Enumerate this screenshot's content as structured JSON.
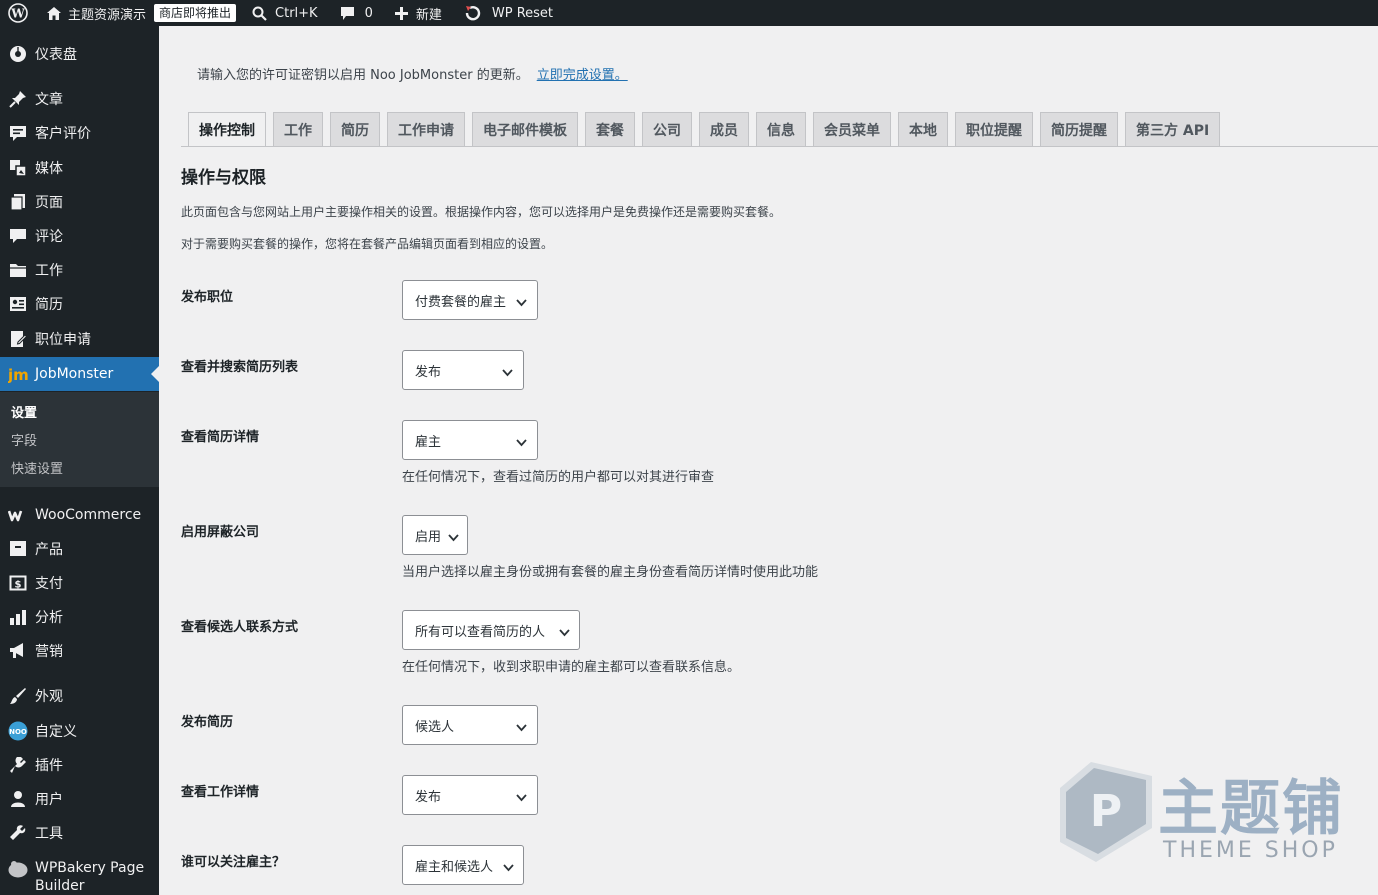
{
  "admin_bar": {
    "site_name": "主题资源演示",
    "store_badge": "商店即将推出",
    "search_shortcut": "Ctrl+K",
    "comments_count": "0",
    "new_label": "新建",
    "wp_reset_label": "WP Reset"
  },
  "sidebar": {
    "items": [
      {
        "label": "仪表盘",
        "icon": "dashboard-icon"
      },
      {
        "label": "文章",
        "icon": "pin-icon"
      },
      {
        "label": "客户评价",
        "icon": "testimonial-icon"
      },
      {
        "label": "媒体",
        "icon": "media-icon"
      },
      {
        "label": "页面",
        "icon": "page-icon"
      },
      {
        "label": "评论",
        "icon": "comment-icon"
      },
      {
        "label": "工作",
        "icon": "folder-icon"
      },
      {
        "label": "简历",
        "icon": "resume-icon"
      },
      {
        "label": "职位申请",
        "icon": "application-icon"
      },
      {
        "label": "JobMonster",
        "icon": "jobmonster-icon"
      },
      {
        "label": "WooCommerce",
        "icon": "woocommerce-icon"
      },
      {
        "label": "产品",
        "icon": "product-icon"
      },
      {
        "label": "支付",
        "icon": "payment-icon"
      },
      {
        "label": "分析",
        "icon": "analytics-icon"
      },
      {
        "label": "营销",
        "icon": "megaphone-icon"
      },
      {
        "label": "外观",
        "icon": "brush-icon"
      },
      {
        "label": "自定义",
        "icon": "noo-icon"
      },
      {
        "label": "插件",
        "icon": "plugin-icon"
      },
      {
        "label": "用户",
        "icon": "user-icon"
      },
      {
        "label": "工具",
        "icon": "wrench-icon"
      },
      {
        "label": "WPBakery Page Builder",
        "icon": "wpbakery-icon"
      }
    ],
    "submenu": [
      "设置",
      "字段",
      "快速设置"
    ]
  },
  "notice": {
    "text": "请输入您的许可证密钥以启用 Noo JobMonster 的更新。",
    "link": "立即完成设置。"
  },
  "tabs": [
    "操作控制",
    "工作",
    "简历",
    "工作申请",
    "电子邮件模板",
    "套餐",
    "公司",
    "成员",
    "信息",
    "会员菜单",
    "本地",
    "职位提醒",
    "简历提醒",
    "第三方 API"
  ],
  "section": {
    "title": "操作与权限",
    "desc1": "此页面包含与您网站上用户主要操作相关的设置。根据操作内容，您可以选择用户是免费操作还是需要购买套餐。",
    "desc2": "对于需要购买套餐的操作，您将在套餐产品编辑页面看到相应的设置。"
  },
  "settings": [
    {
      "label": "发布职位",
      "value": "付费套餐的雇主",
      "help": ""
    },
    {
      "label": "查看并搜索简历列表",
      "value": "发布",
      "help": ""
    },
    {
      "label": "查看简历详情",
      "value": "雇主",
      "help": "在任何情况下，查看过简历的用户都可以对其进行审查"
    },
    {
      "label": "启用屏蔽公司",
      "value": "启用",
      "help": "当用户选择以雇主身份或拥有套餐的雇主身份查看简历详情时使用此功能"
    },
    {
      "label": "查看候选人联系方式",
      "value": "所有可以查看简历的人",
      "help": "在任何情况下，收到求职申请的雇主都可以查看联系信息。"
    },
    {
      "label": "发布简历",
      "value": "候选人",
      "help": ""
    },
    {
      "label": "查看工作详情",
      "value": "发布",
      "help": ""
    },
    {
      "label": "谁可以关注雇主？",
      "value": "雇主和候选人",
      "help": ""
    }
  ],
  "watermark": {
    "cn": "主题铺",
    "en": "THEME SHOP"
  },
  "colors": {
    "admin_bar": "#1d2327",
    "accent": "#2271b1",
    "background": "#f0f0f1"
  }
}
